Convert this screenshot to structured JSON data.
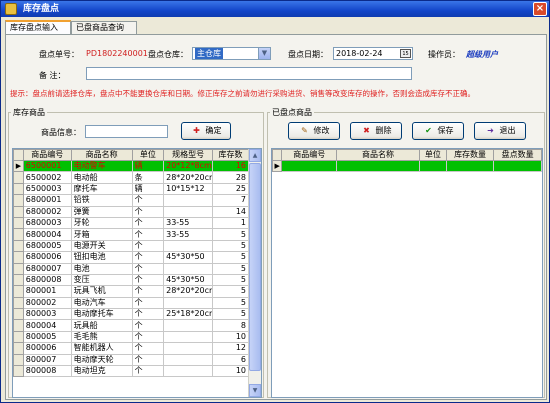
{
  "window": {
    "title": "库存盘点",
    "close_label": "×"
  },
  "tabs": [
    {
      "label": "库存盘点输入"
    },
    {
      "label": "已盘商品查询"
    }
  ],
  "form": {
    "order_no_label": "盘点单号：",
    "order_no_value": "PD1802240001",
    "warehouse_label": "盘点仓库：",
    "warehouse_value": "主仓库",
    "date_label": "盘点日期：",
    "date_value": "2018-02-24",
    "operator_label": "操作员：",
    "operator_value": "超级用户",
    "remark_label": "备    注：",
    "remark_value": ""
  },
  "hint": "提示：盘点前请选择仓库，盘点中不能更换仓库和日期。修正库存之前请勿进行采购进货、销售等改变库存的操作，否则会造成库存不正确。",
  "left": {
    "title": "库存商品",
    "search_label": "商品信息：",
    "search_value": "",
    "confirm_label": "确定",
    "columns": [
      "商品编号",
      "商品名称",
      "单位",
      "规格型号",
      "库存数"
    ],
    "rows": [
      [
        "6500001",
        "电动警车",
        "辆",
        "20*12*8cm",
        "16"
      ],
      [
        "6500002",
        "电动船",
        "条",
        "28*20*20cm",
        "28"
      ],
      [
        "6500003",
        "摩托车",
        "辆",
        "10*15*12",
        "25"
      ],
      [
        "6800001",
        "铅铁",
        "个",
        "",
        "7"
      ],
      [
        "6800002",
        "弹簧",
        "个",
        "",
        "14"
      ],
      [
        "6800003",
        "牙轮",
        "个",
        "33-55",
        "1"
      ],
      [
        "6800004",
        "牙箱",
        "个",
        "33-55",
        "5"
      ],
      [
        "6800005",
        "电源开关",
        "个",
        "",
        "5"
      ],
      [
        "6800006",
        "钮扣电池",
        "个",
        "45*30*50",
        "5"
      ],
      [
        "6800007",
        "电池",
        "个",
        "",
        "5"
      ],
      [
        "6800008",
        "变压",
        "个",
        "45*30*50",
        "5"
      ],
      [
        "800001",
        "玩具飞机",
        "个",
        "28*20*20cm",
        "5"
      ],
      [
        "800002",
        "电动汽车",
        "个",
        "",
        "5"
      ],
      [
        "800003",
        "电动摩托车",
        "个",
        "25*18*20cm",
        "5"
      ],
      [
        "800004",
        "玩具船",
        "个",
        "",
        "8"
      ],
      [
        "800005",
        "毛毛熊",
        "个",
        "",
        "10"
      ],
      [
        "800006",
        "智能机器人",
        "个",
        "",
        "12"
      ],
      [
        "800007",
        "电动摩天轮",
        "个",
        "",
        "6"
      ],
      [
        "800008",
        "电动坦克",
        "个",
        "",
        "10"
      ]
    ]
  },
  "right": {
    "title": "已盘点商品",
    "edit_label": "修改",
    "delete_label": "删除",
    "save_label": "保存",
    "exit_label": "退出",
    "columns": [
      "商品编号",
      "商品名称",
      "单位",
      "库存数量",
      "盘点数量"
    ]
  }
}
